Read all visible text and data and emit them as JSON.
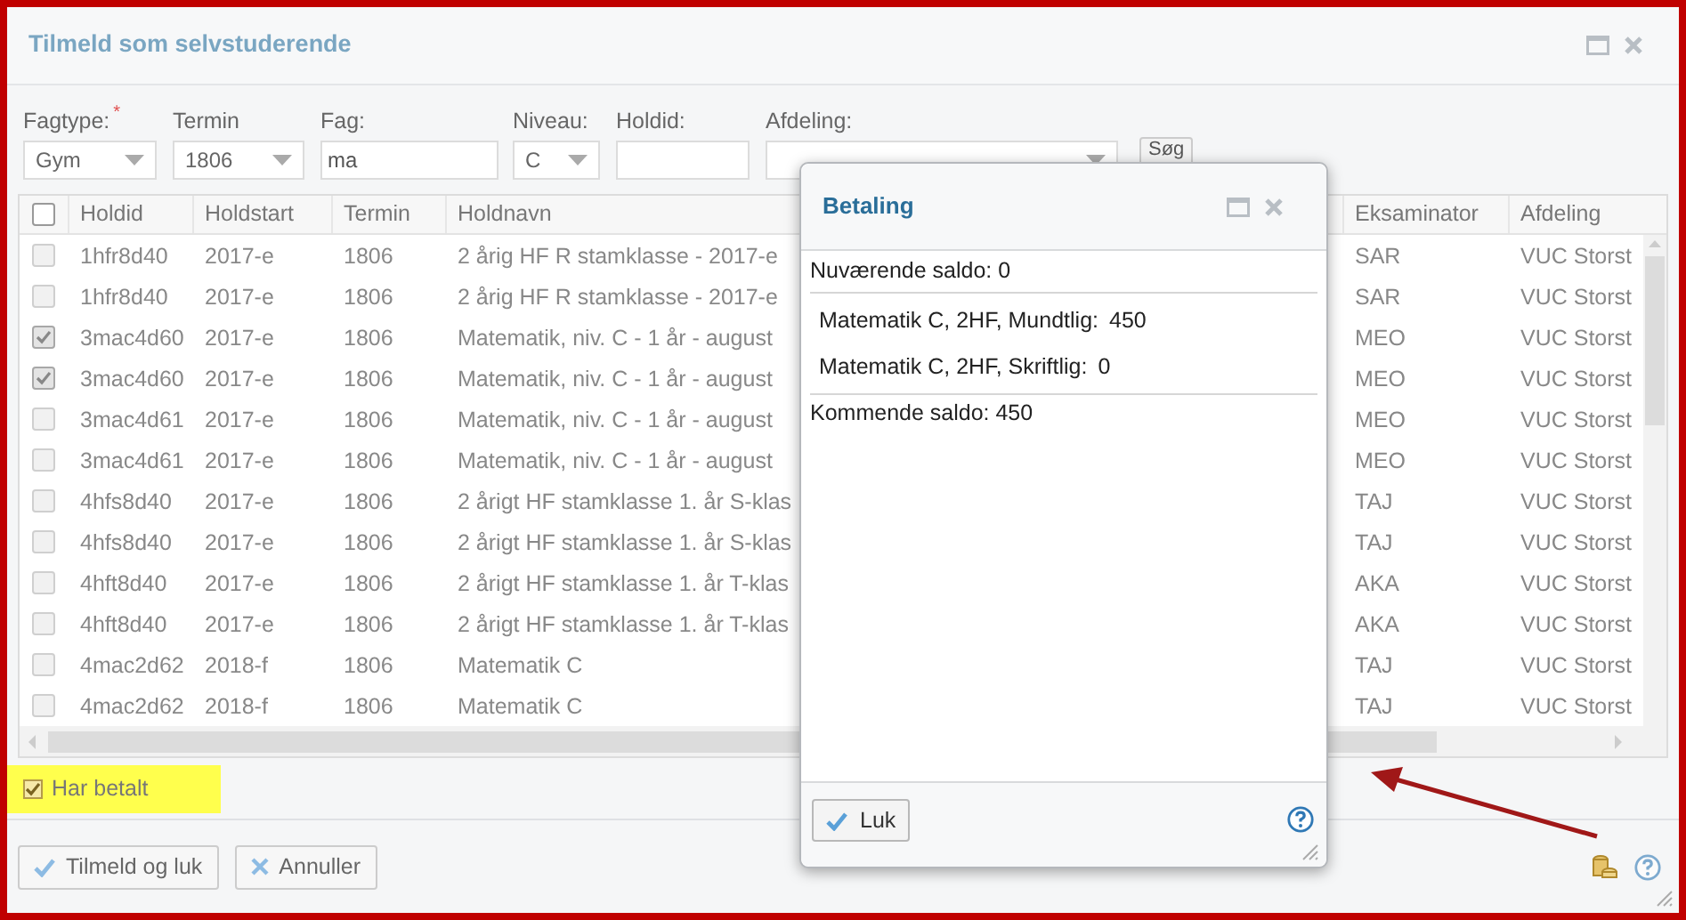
{
  "dialog": {
    "title": "Tilmeld som selvstuderende",
    "filters": [
      {
        "kind": "select",
        "label": "Fagtype:",
        "required_mark": "*",
        "value": "Gym"
      },
      {
        "kind": "select",
        "label": "Termin",
        "value": "1806"
      },
      {
        "kind": "text",
        "label": "Fag:",
        "value": "ma"
      },
      {
        "kind": "select",
        "label": "Niveau:",
        "value": "C"
      },
      {
        "kind": "text",
        "label": "Holdid:"
      },
      {
        "kind": "select",
        "label": "Afdeling:"
      }
    ],
    "search_button": "Søg",
    "table": {
      "header_checked": false,
      "columns": [
        "Holdid",
        "Holdstart",
        "Termin",
        "Holdnavn",
        "Eksaminator",
        "Afdeling"
      ],
      "rows": [
        {
          "checked": false,
          "cells": [
            "1hfr8d40",
            "2017-e",
            "1806",
            "2 årig HF R stamklasse - 2017-e",
            "SAR",
            "VUC Storst"
          ]
        },
        {
          "checked": false,
          "cells": [
            "1hfr8d40",
            "2017-e",
            "1806",
            "2 årig HF R stamklasse - 2017-e",
            "SAR",
            "VUC Storst"
          ]
        },
        {
          "checked": true,
          "cells": [
            "3mac4d60",
            "2017-e",
            "1806",
            "Matematik, niv. C - 1 år - august",
            "MEO",
            "VUC Storst"
          ]
        },
        {
          "checked": true,
          "cells": [
            "3mac4d60",
            "2017-e",
            "1806",
            "Matematik, niv. C - 1 år - august",
            "MEO",
            "VUC Storst"
          ]
        },
        {
          "checked": false,
          "cells": [
            "3mac4d61",
            "2017-e",
            "1806",
            "Matematik, niv. C - 1 år - august",
            "MEO",
            "VUC Storst"
          ]
        },
        {
          "checked": false,
          "cells": [
            "3mac4d61",
            "2017-e",
            "1806",
            "Matematik, niv. C - 1 år - august",
            "MEO",
            "VUC Storst"
          ]
        },
        {
          "checked": false,
          "cells": [
            "4hfs8d40",
            "2017-e",
            "1806",
            "2 årigt HF stamklasse 1. år S-klas",
            "TAJ",
            "VUC Storst"
          ]
        },
        {
          "checked": false,
          "cells": [
            "4hfs8d40",
            "2017-e",
            "1806",
            "2 årigt HF stamklasse 1. år S-klas",
            "TAJ",
            "VUC Storst"
          ]
        },
        {
          "checked": false,
          "cells": [
            "4hft8d40",
            "2017-e",
            "1806",
            "2 årigt HF stamklasse 1. år T-klas",
            "AKA",
            "VUC Storst"
          ]
        },
        {
          "checked": false,
          "cells": [
            "4hft8d40",
            "2017-e",
            "1806",
            "2 årigt HF stamklasse 1. år T-klas",
            "AKA",
            "VUC Storst"
          ]
        },
        {
          "checked": false,
          "cells": [
            "4mac2d62",
            "2018-f",
            "1806",
            "Matematik C",
            "TAJ",
            "VUC Storst"
          ]
        },
        {
          "checked": false,
          "cells": [
            "4mac2d62",
            "2018-f",
            "1806",
            "Matematik C",
            "TAJ",
            "VUC Storst"
          ]
        }
      ]
    },
    "paid": {
      "label": "Har betalt",
      "checked": true
    },
    "buttons": [
      {
        "kind": "ok",
        "label": "Tilmeld og luk"
      },
      {
        "kind": "cancel",
        "label": "Annuller"
      }
    ]
  },
  "payment_dialog": {
    "title": "Betaling",
    "current": "Nuværende saldo: 0",
    "items": [
      {
        "label": "Matematik C, 2HF, Mundtlig:",
        "amount": "450"
      },
      {
        "label": "Matematik C, 2HF, Skriftlig:",
        "amount": "0"
      }
    ],
    "upcoming": "Kommende saldo: 450",
    "button": "Luk"
  }
}
